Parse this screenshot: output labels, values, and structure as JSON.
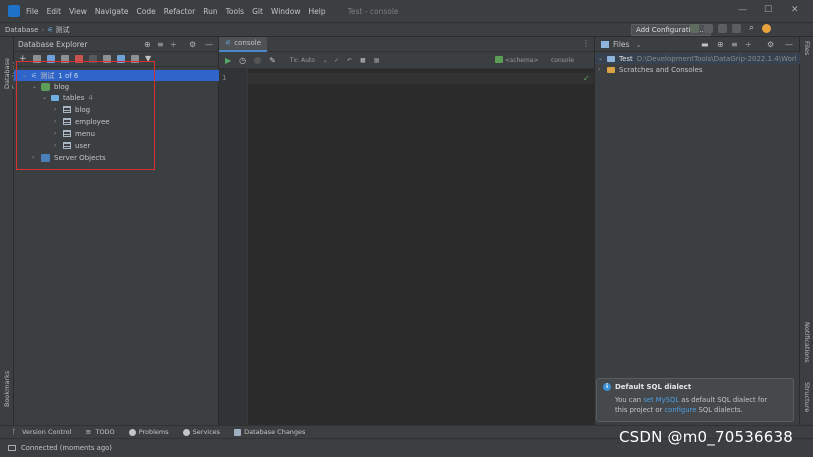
{
  "menu": {
    "items": [
      "File",
      "Edit",
      "View",
      "Navigate",
      "Code",
      "Refactor",
      "Run",
      "Tools",
      "Git",
      "Window",
      "Help"
    ],
    "window_title": "Test - console",
    "minimize": "—",
    "maximize": "☐",
    "close": "✕"
  },
  "navbar": {
    "crumbs": [
      "Database",
      "测试"
    ],
    "add_configuration": "Add Configuration..."
  },
  "left_stripe": {
    "database_explorer": "Database Explorer",
    "bookmarks": "Bookmarks"
  },
  "right_stripe": {
    "files": "Files",
    "notifications": "Notifications",
    "structure": "Structure"
  },
  "db_explorer": {
    "title": "Database Explorer",
    "tree": [
      {
        "label": "测试",
        "extra": "1 of 6"
      },
      {
        "label": "blog",
        "extra": ""
      },
      {
        "label": "tables",
        "extra": "4"
      },
      {
        "label": "blog",
        "extra": ""
      },
      {
        "label": "employee",
        "extra": ""
      },
      {
        "label": "menu",
        "extra": ""
      },
      {
        "label": "user",
        "extra": ""
      },
      {
        "label": "Server Objects",
        "extra": ""
      }
    ]
  },
  "editor": {
    "tab": "console",
    "tx_label": "Tx: Auto",
    "schema_label": "<schema>",
    "console_label": "console",
    "line_number": "1"
  },
  "files_panel": {
    "title": "Files",
    "root_label": "Test",
    "root_path": "D:\\DevelopmentTools\\DataGrip-2022.1.4\\Worl",
    "scratches": "Scratches and Consoles"
  },
  "notification": {
    "title": "Default SQL dialect",
    "text_1": "You can ",
    "link_1": "set MySQL",
    "text_2": " as default SQL dialect for",
    "text_3": "this project or ",
    "link_2": "configure",
    "text_4": " SQL dialects."
  },
  "bottom_tools": [
    "Version Control",
    "TODO",
    "Problems",
    "Services",
    "Database Changes"
  ],
  "status": {
    "text": "Connected (moments ago)"
  },
  "watermark": "CSDN @m0_70536638",
  "colors": {
    "selection": "#2f65ca",
    "highlight_box": "#d93030",
    "link": "#4b9fe5"
  }
}
